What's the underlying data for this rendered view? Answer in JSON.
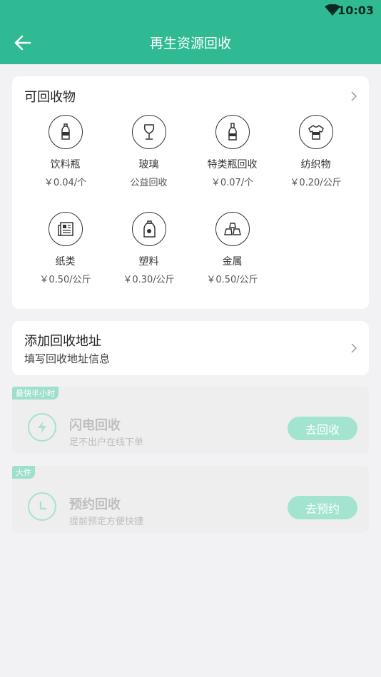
{
  "status": {
    "time": "10:03"
  },
  "header": {
    "title": "再生资源回收"
  },
  "recyclables": {
    "title": "可回收物",
    "items": [
      {
        "name": "饮料瓶",
        "price": "￥0.04/个",
        "icon": "bottle-icon"
      },
      {
        "name": "玻璃",
        "price": "公益回收",
        "icon": "wine-glass-icon"
      },
      {
        "name": "特类瓶回收",
        "price": "￥0.07/个",
        "icon": "special-bottle-icon"
      },
      {
        "name": "纺织物",
        "price": "￥0.20/公斤",
        "icon": "shirt-icon"
      },
      {
        "name": "纸类",
        "price": "￥0.50/公斤",
        "icon": "newspaper-icon"
      },
      {
        "name": "塑料",
        "price": "￥0.30/公斤",
        "icon": "plastic-jug-icon"
      },
      {
        "name": "金属",
        "price": "￥0.50/公斤",
        "icon": "metal-bars-icon"
      }
    ]
  },
  "address": {
    "title": "添加回收地址",
    "subtitle": "填写回收地址信息"
  },
  "services": [
    {
      "tag": "最快半小时",
      "title": "闪电回收",
      "subtitle": "足不出户在线下单",
      "button": "去回收",
      "icon": "lightning-icon"
    },
    {
      "tag": "大件",
      "title": "预约回收",
      "subtitle": "提前预定方便快捷",
      "button": "去预约",
      "icon": "clock-icon"
    }
  ],
  "colors": {
    "primary": "#2fba93",
    "button_disabled": "#a3e4d1"
  }
}
